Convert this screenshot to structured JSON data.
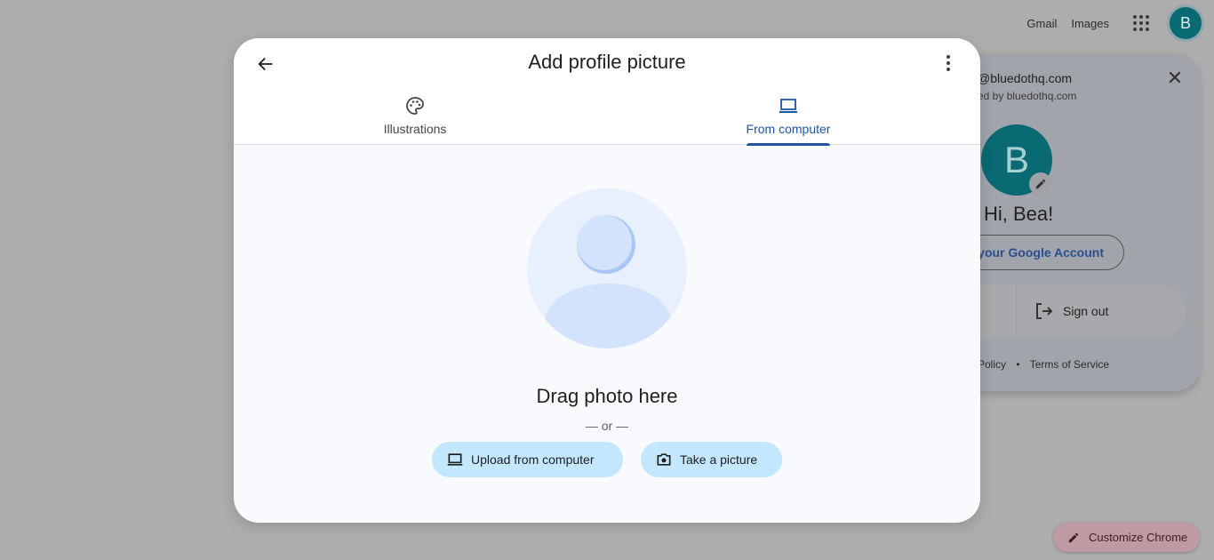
{
  "topbar": {
    "gmail": "Gmail",
    "images": "Images",
    "avatar_letter": "B"
  },
  "account_panel": {
    "email": "@bluedothq.com",
    "managed_by": "ed by bluedothq.com",
    "avatar_letter": "B",
    "greeting": "Hi, Bea!",
    "manage_account": "your Google Account",
    "sign_out": "Sign out",
    "privacy_policy": "Policy",
    "separator": "•",
    "terms": "Terms of Service",
    "avatar_color": "#0a6a74"
  },
  "customize": {
    "label": "Customize Chrome"
  },
  "dialog": {
    "title": "Add profile picture",
    "tabs": [
      {
        "label": "Illustrations",
        "icon": "palette-icon",
        "active": false
      },
      {
        "label": "From computer",
        "icon": "laptop-icon",
        "active": true
      }
    ],
    "drag_text": "Drag photo here",
    "or_text": "— or —",
    "upload_button": "Upload from computer",
    "camera_button": "Take a picture",
    "accent_color": "#1f56a0",
    "button_color": "#c2e7ff"
  }
}
